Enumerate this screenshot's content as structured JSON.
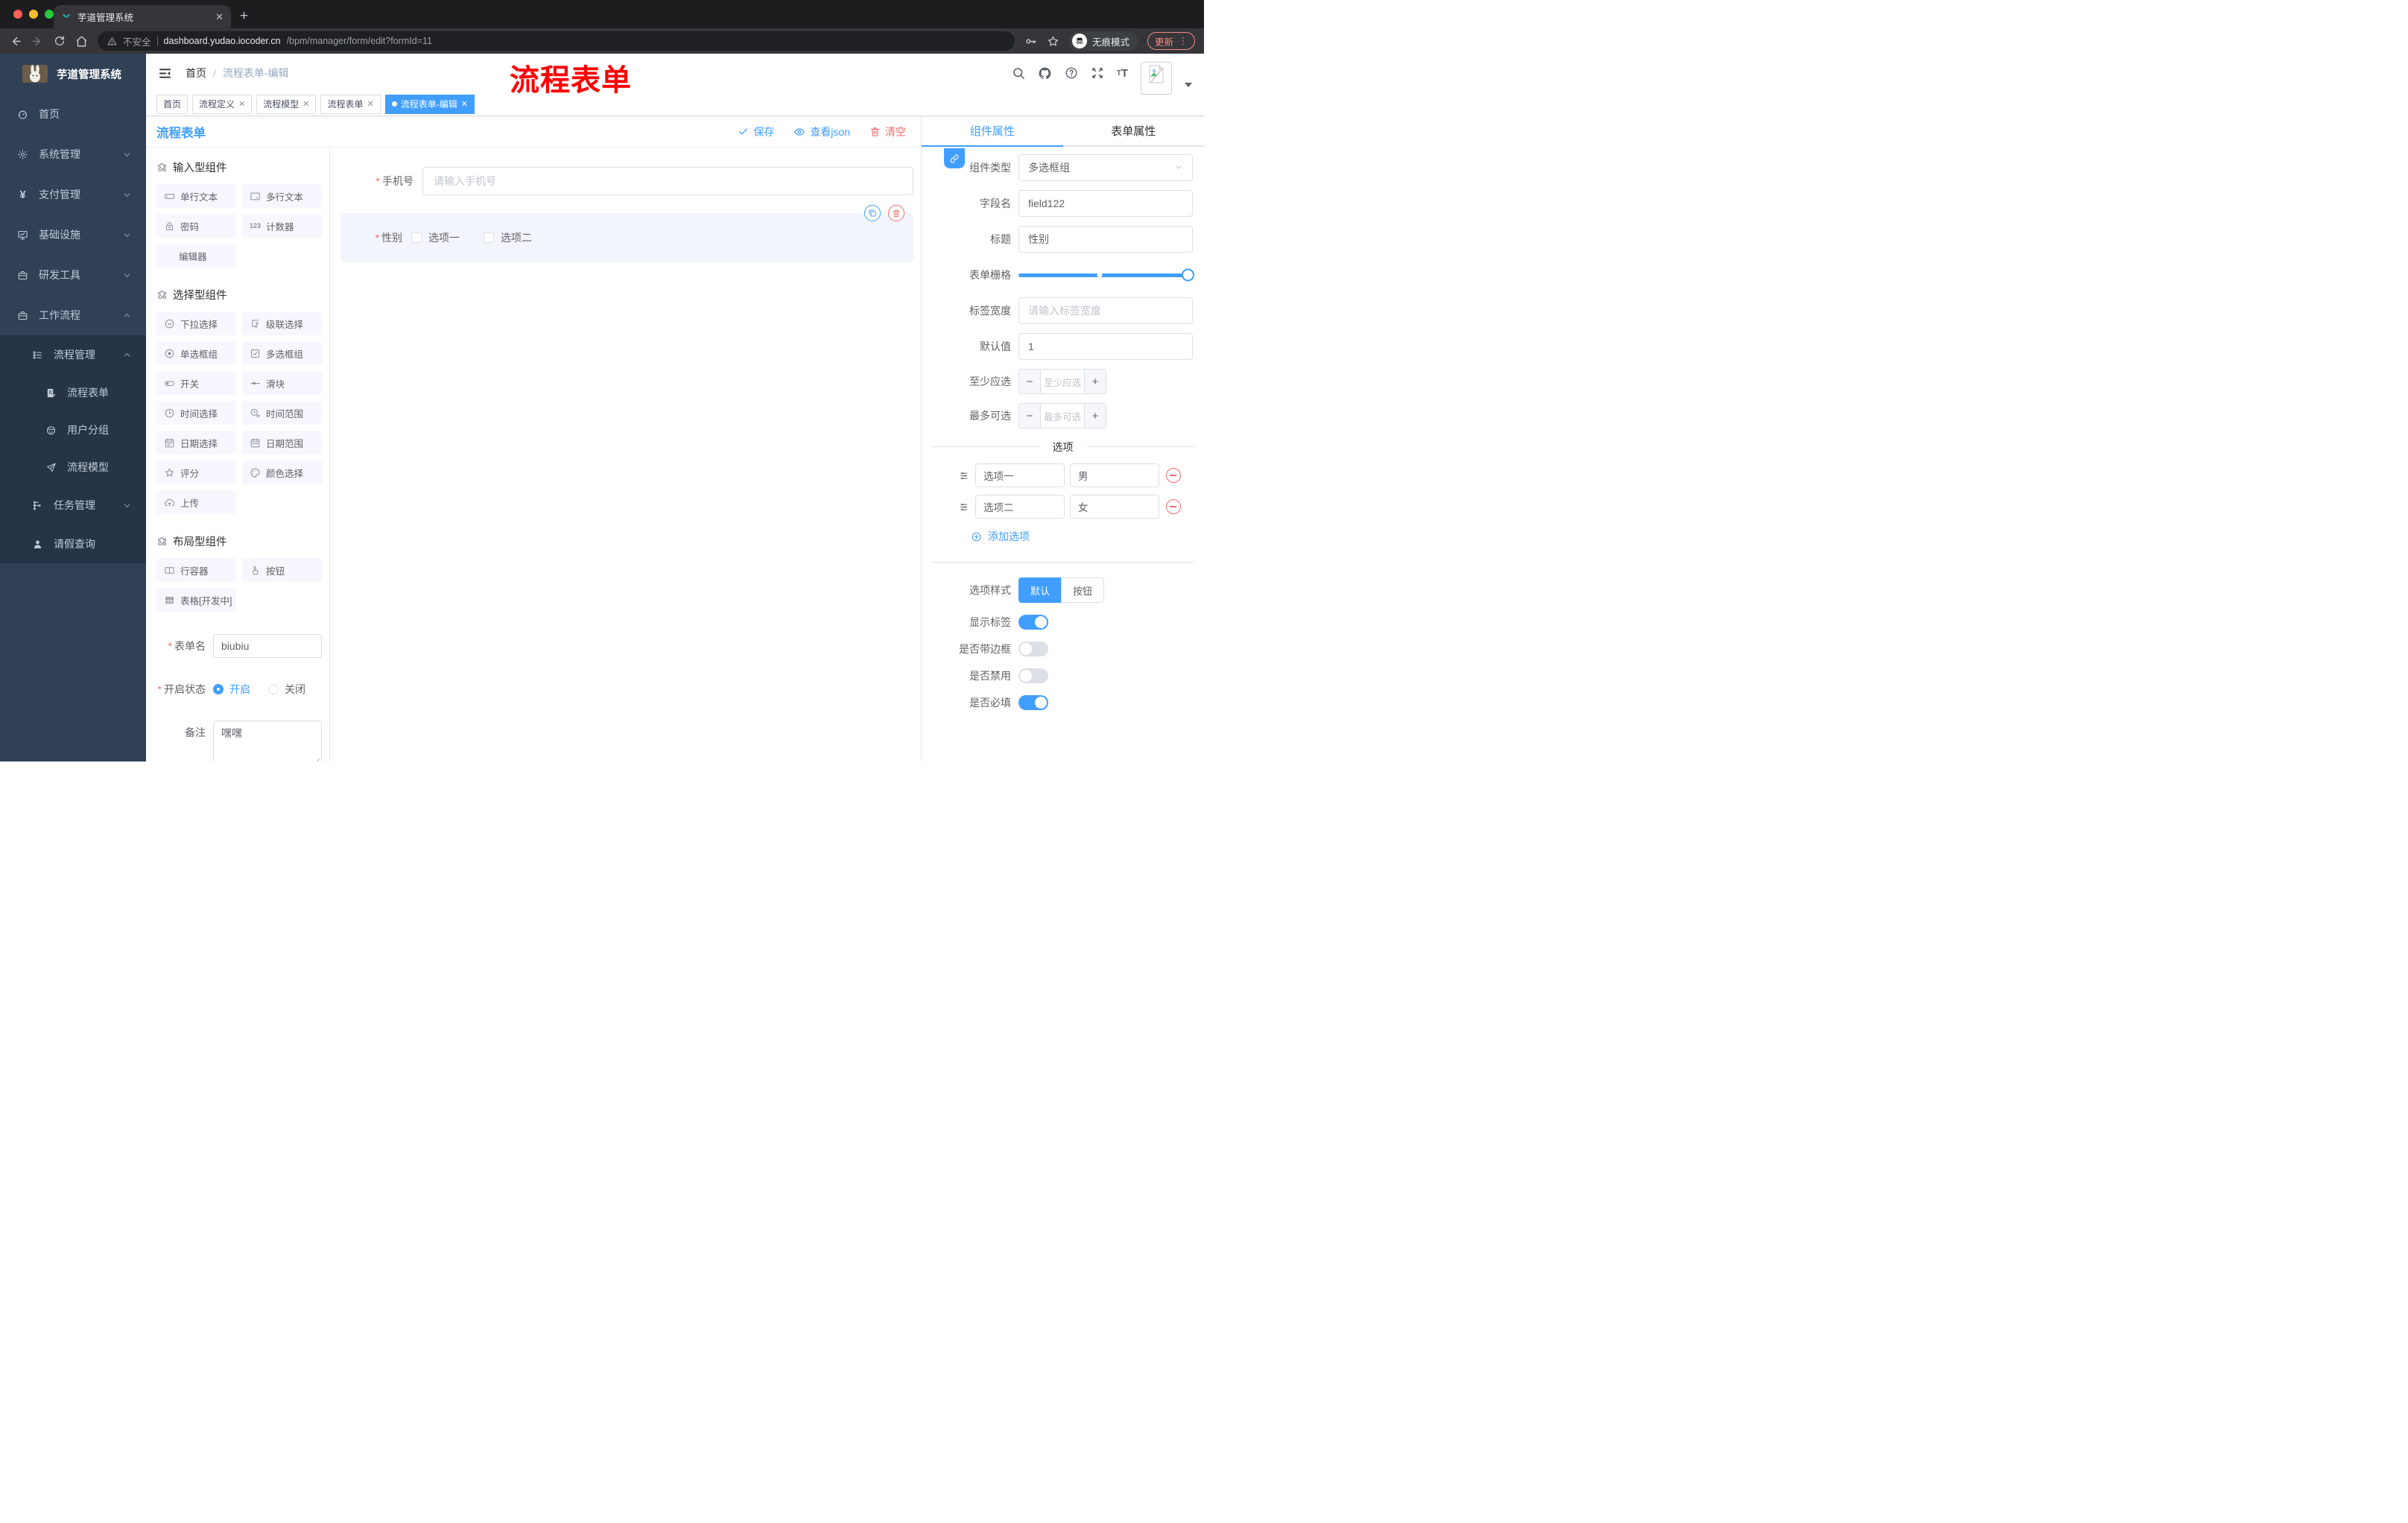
{
  "colors": {
    "primary": "#409eff",
    "danger": "#f56c6c",
    "annotation": "#ff0000",
    "sidebar_bg": "#304156",
    "sidebar_sub_bg": "#263445"
  },
  "browser": {
    "tab_title": "芋道管理系统",
    "not_secure": "不安全",
    "url_host": "dashboard.yudao.iocoder.cn",
    "url_path": "/bpm/manager/form/edit?formId=11",
    "incognito_label": "无痕模式",
    "update_label": "更新"
  },
  "sidebar": {
    "title": "芋道管理系统",
    "items": [
      {
        "icon": "dashboard",
        "label": "首页",
        "level": 1,
        "sub": false,
        "chevron": ""
      },
      {
        "icon": "gear",
        "label": "系统管理",
        "level": 1,
        "sub": false,
        "chevron": "down"
      },
      {
        "icon": "yen",
        "label": "支付管理",
        "level": 1,
        "sub": false,
        "chevron": "down"
      },
      {
        "icon": "monitor",
        "label": "基础设施",
        "level": 1,
        "sub": false,
        "chevron": "down"
      },
      {
        "icon": "briefcase",
        "label": "研发工具",
        "level": 1,
        "sub": false,
        "chevron": "down"
      },
      {
        "icon": "briefcase",
        "label": "工作流程",
        "level": 1,
        "sub": false,
        "chevron": "up"
      },
      {
        "icon": "list-tree",
        "label": "流程管理",
        "level": 2,
        "sub": true,
        "chevron": "up"
      },
      {
        "icon": "doc-edit",
        "label": "流程表单",
        "level": 3,
        "sub": true,
        "chevron": ""
      },
      {
        "icon": "robot",
        "label": "用户分组",
        "level": 3,
        "sub": true,
        "chevron": ""
      },
      {
        "icon": "send",
        "label": "流程模型",
        "level": 3,
        "sub": true,
        "chevron": ""
      },
      {
        "icon": "tree",
        "label": "任务管理",
        "level": 2,
        "sub": true,
        "chevron": "down"
      },
      {
        "icon": "user",
        "label": "请假查询",
        "level": 2,
        "sub": true,
        "chevron": ""
      }
    ]
  },
  "navbar": {
    "breadcrumb_home": "首页",
    "breadcrumb_sep": "/",
    "breadcrumb_current": "流程表单-编辑",
    "annotation": "流程表单"
  },
  "tags": [
    {
      "label": "首页",
      "closable": false,
      "active": false
    },
    {
      "label": "流程定义",
      "closable": true,
      "active": false
    },
    {
      "label": "流程模型",
      "closable": true,
      "active": false
    },
    {
      "label": "流程表单",
      "closable": true,
      "active": false
    },
    {
      "label": "流程表单-编辑",
      "closable": true,
      "active": true
    }
  ],
  "toolbar": {
    "title": "流程表单",
    "save": "保存",
    "view_json": "查看json",
    "clear": "清空"
  },
  "cpanel": {
    "groups": [
      {
        "title": "输入型组件",
        "items": [
          {
            "icon": "input",
            "label": "单行文本"
          },
          {
            "icon": "textarea",
            "label": "多行文本"
          },
          {
            "icon": "lock",
            "label": "密码"
          },
          {
            "icon": "counter",
            "label": "计数器"
          },
          {
            "icon": "none",
            "label": "编辑器"
          }
        ]
      },
      {
        "title": "选择型组件",
        "items": [
          {
            "icon": "select",
            "label": "下拉选择"
          },
          {
            "icon": "cascader",
            "label": "级联选择"
          },
          {
            "icon": "radio",
            "label": "单选框组"
          },
          {
            "icon": "checkbox",
            "label": "多选框组"
          },
          {
            "icon": "switch",
            "label": "开关"
          },
          {
            "icon": "slider",
            "label": "滑块"
          },
          {
            "icon": "time",
            "label": "时间选择"
          },
          {
            "icon": "time-range",
            "label": "时间范围"
          },
          {
            "icon": "date",
            "label": "日期选择"
          },
          {
            "icon": "date-range",
            "label": "日期范围"
          },
          {
            "icon": "rate",
            "label": "评分"
          },
          {
            "icon": "color",
            "label": "颜色选择"
          },
          {
            "icon": "upload",
            "label": "上传"
          }
        ]
      },
      {
        "title": "布局型组件",
        "items": [
          {
            "icon": "row",
            "label": "行容器"
          },
          {
            "icon": "hand",
            "label": "按钮"
          },
          {
            "icon": "table",
            "label": "表格[开发中]"
          }
        ]
      }
    ],
    "form": {
      "name_label": "表单名",
      "name_value": "biubiu",
      "status_label": "开启状态",
      "status_on": "开启",
      "status_off": "关闭",
      "remark_label": "备注",
      "remark_value": "嘿嘿"
    }
  },
  "canvas": {
    "phone_label": "手机号",
    "phone_placeholder": "请输入手机号",
    "gender_label": "性别",
    "gender_options": [
      "选项一",
      "选项二"
    ]
  },
  "props": {
    "tab_component": "组件属性",
    "tab_form": "表单属性",
    "rows": [
      {
        "label": "组件类型",
        "type": "select",
        "value": "多选框组"
      },
      {
        "label": "字段名",
        "type": "input",
        "value": "field122"
      },
      {
        "label": "标题",
        "type": "input",
        "value": "性别"
      },
      {
        "label": "表单栅格",
        "type": "slider",
        "value": 24,
        "mark_percent": 48
      },
      {
        "label": "标签宽度",
        "type": "input",
        "placeholder": "请输入标签宽度"
      },
      {
        "label": "默认值",
        "type": "input",
        "value": "1"
      },
      {
        "label": "至少应选",
        "type": "stepper",
        "placeholder": "至少应选"
      },
      {
        "label": "最多可选",
        "type": "stepper",
        "placeholder": "最多可选"
      }
    ],
    "options_title": "选项",
    "options": [
      {
        "label": "选项一",
        "value": "男"
      },
      {
        "label": "选项二",
        "value": "女"
      }
    ],
    "add_option": "添加选项",
    "style_label": "选项样式",
    "style_options": [
      "默认",
      "按钮"
    ],
    "style_active": 0,
    "switches": [
      {
        "label": "显示标签",
        "on": true
      },
      {
        "label": "是否带边框",
        "on": false
      },
      {
        "label": "是否禁用",
        "on": false
      },
      {
        "label": "是否必填",
        "on": true
      }
    ]
  }
}
